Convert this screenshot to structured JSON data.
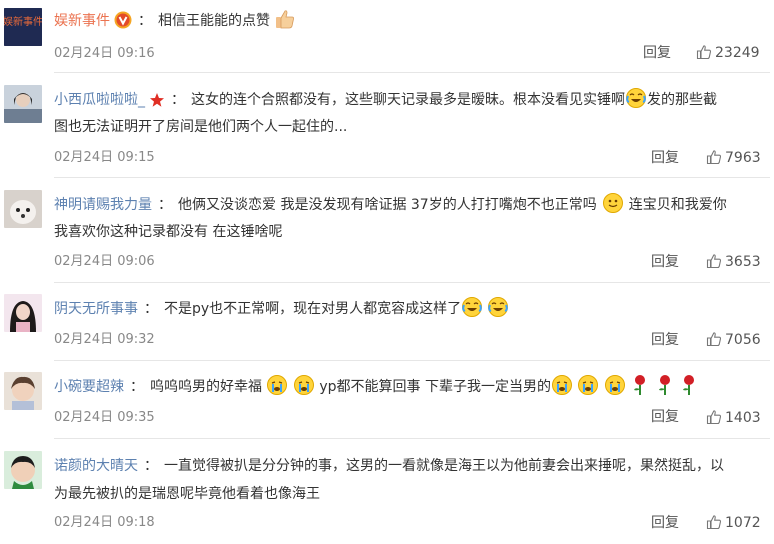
{
  "colors": {
    "orange_name": "#eb7350",
    "blue_name": "#5d81b0",
    "meta": "#888888"
  },
  "icons": {
    "like": "thumbs-up-icon",
    "reply": "reply-link"
  },
  "comments": [
    {
      "user": "娱新事件",
      "name_style": "orange",
      "badge": "verified-v-badge",
      "text": "相信王能能的点赞",
      "time": "02月24日 09:16",
      "reply": "回复",
      "likes": "23249",
      "avatar_text": "娱新事件"
    },
    {
      "user": "小西瓜啦啦啦_",
      "name_style": "blue",
      "badge": "star-badge",
      "text": "这女的连个合照都没有，这些聊天记录最多是暧昧。根本没看见实锤啊",
      "text_b": "发的那些截",
      "text2": "图也无法证明开了房间是他们两个人一起住的...",
      "time": "02月24日 09:15",
      "reply": "回复",
      "likes": "7963"
    },
    {
      "user": "神明请赐我力量",
      "name_style": "blue",
      "text": "他俩又没谈恋爱 我是没发现有啥证据 37岁的人打打嘴炮不也正常吗",
      "text_b": "连宝贝和我爱你",
      "text2": "我喜欢你这种记录都没有 在这锤啥呢",
      "time": "02月24日 09:06",
      "reply": "回复",
      "likes": "3653"
    },
    {
      "user": "阴天无所事事",
      "name_style": "blue",
      "text": "不是py也不正常啊，现在对男人都宽容成这样了",
      "time": "02月24日 09:32",
      "reply": "回复",
      "likes": "7056"
    },
    {
      "user": "小碗要超辣",
      "name_style": "blue",
      "text": "呜呜呜男的好幸福",
      "text_b": "yp都不能算回事 下辈子我一定当男的",
      "time": "02月24日 09:35",
      "reply": "回复",
      "likes": "1403"
    },
    {
      "user": "诺颜的大晴天",
      "name_style": "blue",
      "text": "一直觉得被扒是分分钟的事，这男的一看就像是海王以为他前妻会出来捶呢，果然挺乱，以",
      "text2": "为最先被扒的是瑞恩呢毕竟他看着也像海王",
      "time": "02月24日 09:18",
      "reply": "回复",
      "likes": "1072"
    }
  ]
}
